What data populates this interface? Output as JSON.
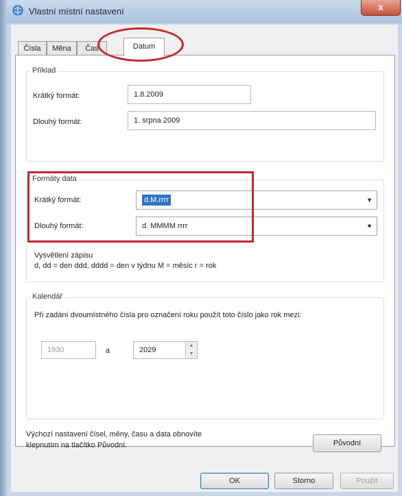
{
  "window": {
    "title": "Vlastní místní nastavení",
    "close_glyph": "x"
  },
  "tabs": [
    {
      "label": "Čísla",
      "active": false
    },
    {
      "label": "Měna",
      "active": false
    },
    {
      "label": "Čas",
      "active": false
    },
    {
      "label": "Datum",
      "active": true
    }
  ],
  "example": {
    "group_label": "Příklad",
    "short_label": "Krátký formát:",
    "short_value": "1.8.2009",
    "long_label": "Dlouhý formát:",
    "long_value": "1. srpna 2009"
  },
  "formats": {
    "group_label": "Formáty data",
    "short_label": "Krátký formát:",
    "short_value": "d.M.rrrr",
    "long_label": "Dlouhý formát:",
    "long_value": "d. MMMM rrrr",
    "notation_title": "Vysvětlení zápisu",
    "notation_text": "d, dd = den  ddd, dddd = den v týdnu  M = měsíc  r = rok"
  },
  "calendar": {
    "group_label": "Kalendář",
    "description": "Při zadání dvoumístného čísla pro označení roku použít toto číslo jako rok mezi:",
    "from_year": "1930",
    "and_label": "a",
    "to_year": "2029"
  },
  "reset": {
    "text_line1": "Výchozí nastavení čísel, měny, času a data obnovíte",
    "text_line2": "klepnutím na tlačítko Původní.",
    "button_label": "Původní"
  },
  "footer": {
    "ok_label": "OK",
    "cancel_label": "Storno",
    "apply_label": "Použít"
  },
  "colors": {
    "annotation_red": "#c2272d",
    "selection_blue": "#3072c4"
  }
}
